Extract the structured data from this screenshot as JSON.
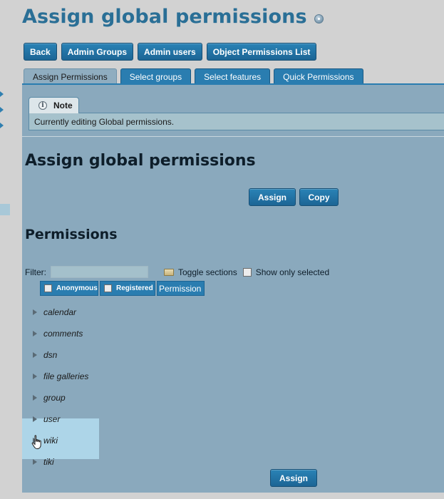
{
  "page": {
    "title": "Assign global permissions"
  },
  "top_buttons": {
    "back": "Back",
    "admin_groups": "Admin Groups",
    "admin_users": "Admin users",
    "object_permissions": "Object Permissions List"
  },
  "tabs": [
    {
      "label": "Assign Permissions",
      "active": true
    },
    {
      "label": "Select groups",
      "active": false
    },
    {
      "label": "Select features",
      "active": false
    },
    {
      "label": "Quick Permissions",
      "active": false
    }
  ],
  "note": {
    "title": "Note",
    "text": "Currently editing Global permissions."
  },
  "section": {
    "heading": "Assign global permissions",
    "assign_label": "Assign",
    "copy_label": "Copy"
  },
  "permissions": {
    "heading": "Permissions",
    "filter_label": "Filter:",
    "filter_value": "",
    "toggle_sections_label": "Toggle sections",
    "show_only_selected_label": "Show only selected",
    "columns": {
      "anonymous": "Anonymous",
      "registered": "Registered",
      "permission": "Permission"
    },
    "categories": [
      "calendar",
      "comments",
      "dsn",
      "file galleries",
      "group",
      "user",
      "wiki",
      "tiki"
    ],
    "bottom_assign_label": "Assign"
  },
  "colors": {
    "title": "#2a6f96",
    "button": "#2a7db0",
    "panel": "#8aa9bd",
    "hover_highlight": "#add5e8"
  }
}
